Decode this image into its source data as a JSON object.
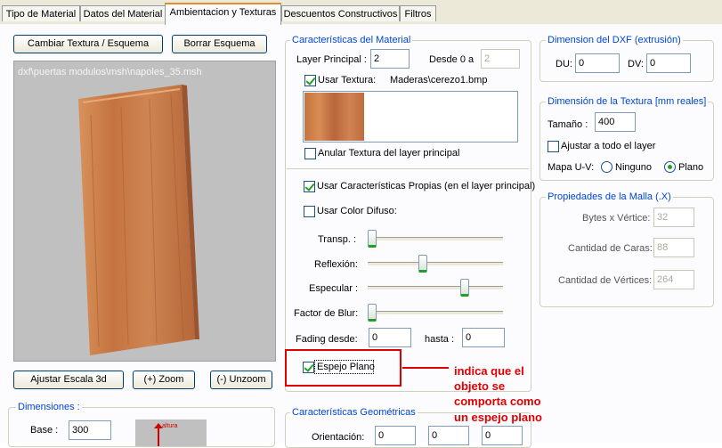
{
  "tabs": [
    "Tipo de Material",
    "Datos del Material",
    "Ambientacion y Texturas",
    "Descuentos Constructivos",
    "Filtros"
  ],
  "left": {
    "change_texture_label": "Cambiar Textura / Esquema",
    "delete_scheme_label": "Borrar Esquema",
    "preview_path": "dxf\\puertas modulos\\msh\\napoles_35.msh",
    "adjust_scale_label": "Ajustar Escala 3d",
    "zoom_label": "(+) Zoom",
    "unzoom_label": "(-) Unzoom",
    "dimensions_title": "Dimensiones :",
    "base_label": "Base :",
    "base_value": "300",
    "height_label": "altura"
  },
  "material": {
    "title": "Características del Material",
    "layer_label": "Layer Principal :",
    "layer_value": "2",
    "from_label": "Desde 0 a",
    "from_value": "2",
    "use_texture_label": "Usar Textura:",
    "use_texture_checked": true,
    "texture_file": "Maderas\\cerezo1.bmp",
    "cancel_texture_label": "Anular Textura del layer principal",
    "cancel_texture_checked": false,
    "own_props_label": "Usar Características Propias (en el layer principal)",
    "own_props_checked": true,
    "diffuse_label": "Usar Color Difuso:",
    "diffuse_checked": false,
    "sliders": [
      {
        "label": "Transp. :",
        "value": 0.0
      },
      {
        "label": "Reflexión:",
        "value": 0.4
      },
      {
        "label": "Especular :",
        "value": 0.73
      },
      {
        "label": "Factor de Blur:",
        "value": 0.0
      }
    ],
    "fading_label": "Fading desde:",
    "fading_from": "0",
    "until_label": "hasta :",
    "fading_to": "0",
    "mirror_label": "Espejo Plano",
    "mirror_checked": true
  },
  "geometry": {
    "title": "Características Geométricas",
    "orientation_label": "Orientación:",
    "orientation_values": [
      "0",
      "0",
      "0"
    ]
  },
  "annotation": {
    "text_lines": [
      "indica que el",
      "objeto se",
      "comporta como",
      "un espejo plano"
    ],
    "color": "#e00000"
  },
  "dxf": {
    "title": "Dimension del DXF (extrusión)",
    "du_label": "DU:",
    "du_value": "0",
    "dv_label": "DV:",
    "dv_value": "0"
  },
  "texture_dim": {
    "title": "Dimensión de la Textura [mm reales]",
    "size_label": "Tamaño :",
    "size_value": "400",
    "adjust_label": "Ajustar a todo el layer",
    "adjust_checked": false,
    "map_label": "Mapa U-V:",
    "options": [
      "Ninguno",
      "Plano"
    ],
    "selected": "Plano"
  },
  "mesh": {
    "title": "Propiedades de la Malla (.X)",
    "bytes_label": "Bytes x Vértice:",
    "bytes_value": "32",
    "faces_label": "Cantidad de Caras:",
    "faces_value": "88",
    "vertices_label": "Cantidad de Vértices:",
    "vertices_value": "264"
  },
  "colors": {
    "accent_tab": "#e68b2c",
    "group_title": "#0046d5",
    "preview_bg": "#c0c0c0",
    "wood": "#c77a45"
  }
}
